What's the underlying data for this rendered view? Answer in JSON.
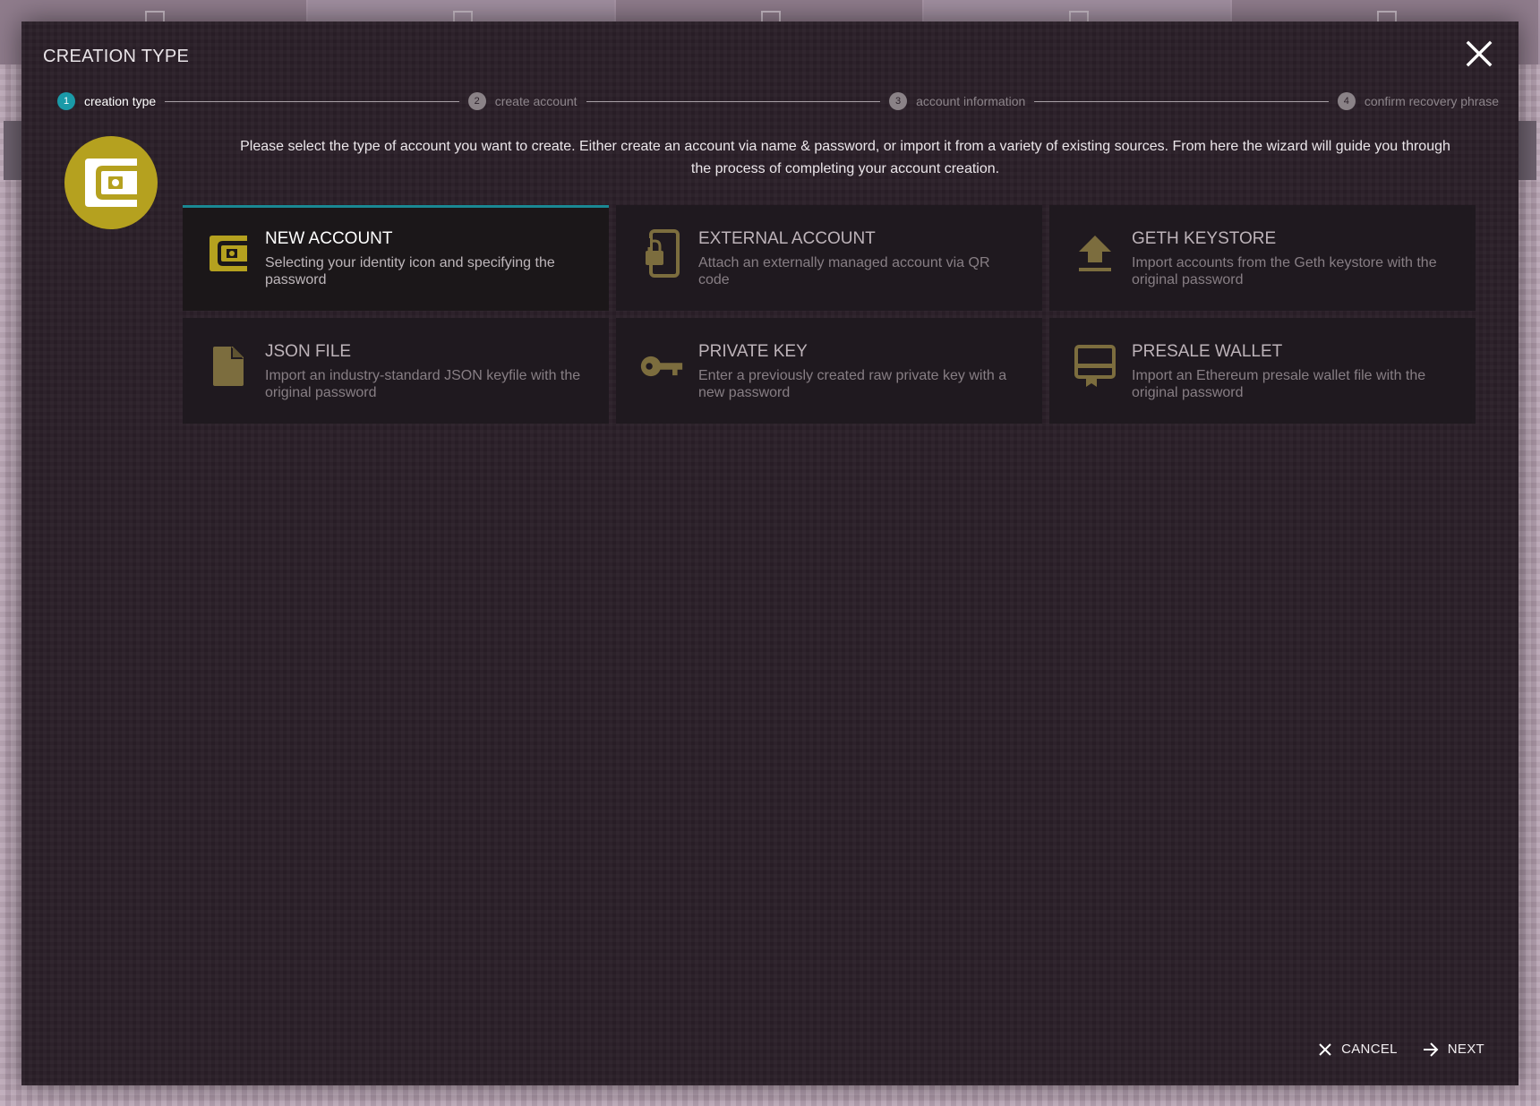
{
  "dialog": {
    "title": "CREATION TYPE",
    "close_icon": "close-icon"
  },
  "steps": [
    {
      "number": "1",
      "label": "creation type",
      "active": true
    },
    {
      "number": "2",
      "label": "create account",
      "active": false
    },
    {
      "number": "3",
      "label": "account information",
      "active": false
    },
    {
      "number": "4",
      "label": "confirm recovery phrase",
      "active": false
    }
  ],
  "intro": "Please select the type of account you want to create. Either create an account via name & password, or import it from a variety of existing sources. From here the wizard will guide you through the process of completing your account creation.",
  "hero_icon": "wallet-icon",
  "options": [
    {
      "title": "NEW ACCOUNT",
      "description": "Selecting your identity icon and specifying the password",
      "icon": "wallet-icon",
      "selected": true
    },
    {
      "title": "EXTERNAL ACCOUNT",
      "description": "Attach an externally managed account via QR code",
      "icon": "phone-lock-icon",
      "selected": false
    },
    {
      "title": "GETH KEYSTORE",
      "description": "Import accounts from the Geth keystore with the original password",
      "icon": "upload-icon",
      "selected": false
    },
    {
      "title": "JSON FILE",
      "description": "Import an industry-standard JSON keyfile with the original password",
      "icon": "file-icon",
      "selected": false
    },
    {
      "title": "PRIVATE KEY",
      "description": "Enter a previously created raw private key with a new password",
      "icon": "key-icon",
      "selected": false
    },
    {
      "title": "PRESALE WALLET",
      "description": "Import an Ethereum presale wallet file with the original password",
      "icon": "card-membership-icon",
      "selected": false
    }
  ],
  "footer": {
    "cancel_label": "CANCEL",
    "next_label": "NEXT"
  },
  "colors": {
    "accent_teal": "#1a9aa8",
    "icon_gold": "#b5a11f",
    "icon_muted_gold": "#7c6d3e",
    "modal_bg": "#2a1f28"
  }
}
